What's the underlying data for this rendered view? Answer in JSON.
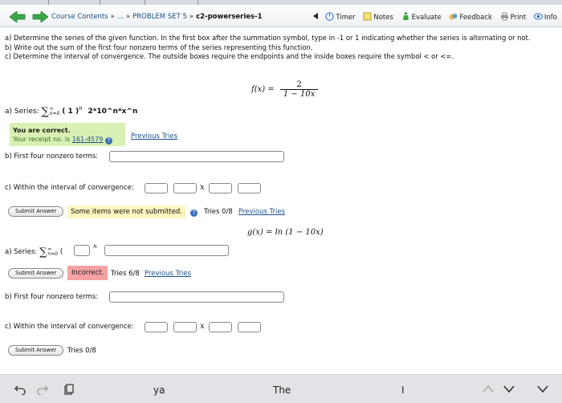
{
  "nav": {
    "breadcrumb_course": "Course Contents",
    "breadcrumb_sep": "»",
    "breadcrumb_ellipsis": "...",
    "breadcrumb_set": "PROBLEM SET 5",
    "breadcrumb_current": "c2-powerseries-1",
    "tools": [
      "Timer",
      "Notes",
      "Evaluate",
      "Feedback",
      "Print",
      "Info"
    ]
  },
  "instructions": {
    "a": "a) Determine the series of the given function. In the first box after the summation symbol, type in -1 or 1 indicating whether the series is alternating or not.",
    "b": "b) Write out the sum of the first four nonzero terms of the series representing this function.",
    "c": "c) Determine the interval of convergence. The outside boxes require the endpoints and the inside boxes require the symbol < or <=."
  },
  "problem1": {
    "fx_label": "f(x) =",
    "fx_num": "2",
    "fx_den": "1 − 10x",
    "series_label": "a) Series:",
    "sigma": "∑",
    "sigma_upper": "∞",
    "sigma_lower": "n=0",
    "series_body_open": "( 1 )",
    "series_exp": "n",
    "series_answer": "2*10^n*x^n",
    "correct_title": "You are correct.",
    "receipt_prefix": "Your receipt no. is",
    "receipt_no": "161-4579",
    "previous_tries": "Previous Tries",
    "terms_label": "b) First four nonzero terms:",
    "interval_label": "c) Within the interval of convergence:",
    "x_var": "x",
    "submit": "Submit Answer",
    "status": "Some items were not submitted.",
    "tries": "Tries 0/8",
    "tries_link": "Previous Tries"
  },
  "problem2": {
    "gx": "g(x) = ln (1 − 10x)",
    "series_label": "a) Series:",
    "series_exp": "n",
    "submit": "Submit Answer",
    "status": "Incorrect.",
    "tries": "Tries 6/8",
    "tries_link": "Previous Tries",
    "terms_label": "b) First four nonzero terms:",
    "interval_label": "c) Within the interval of convergence:",
    "x_var": "x",
    "submit2": "Submit Answer",
    "tries2": "Tries 0/8"
  },
  "keyboard": {
    "suggestions": [
      "ya",
      "The",
      "I"
    ]
  },
  "colors": {
    "correct_bg": "#d9f0b4",
    "warning_bg": "#fcf6bf",
    "incorrect_bg": "#f5a1a1",
    "link": "#1a4f8a"
  }
}
